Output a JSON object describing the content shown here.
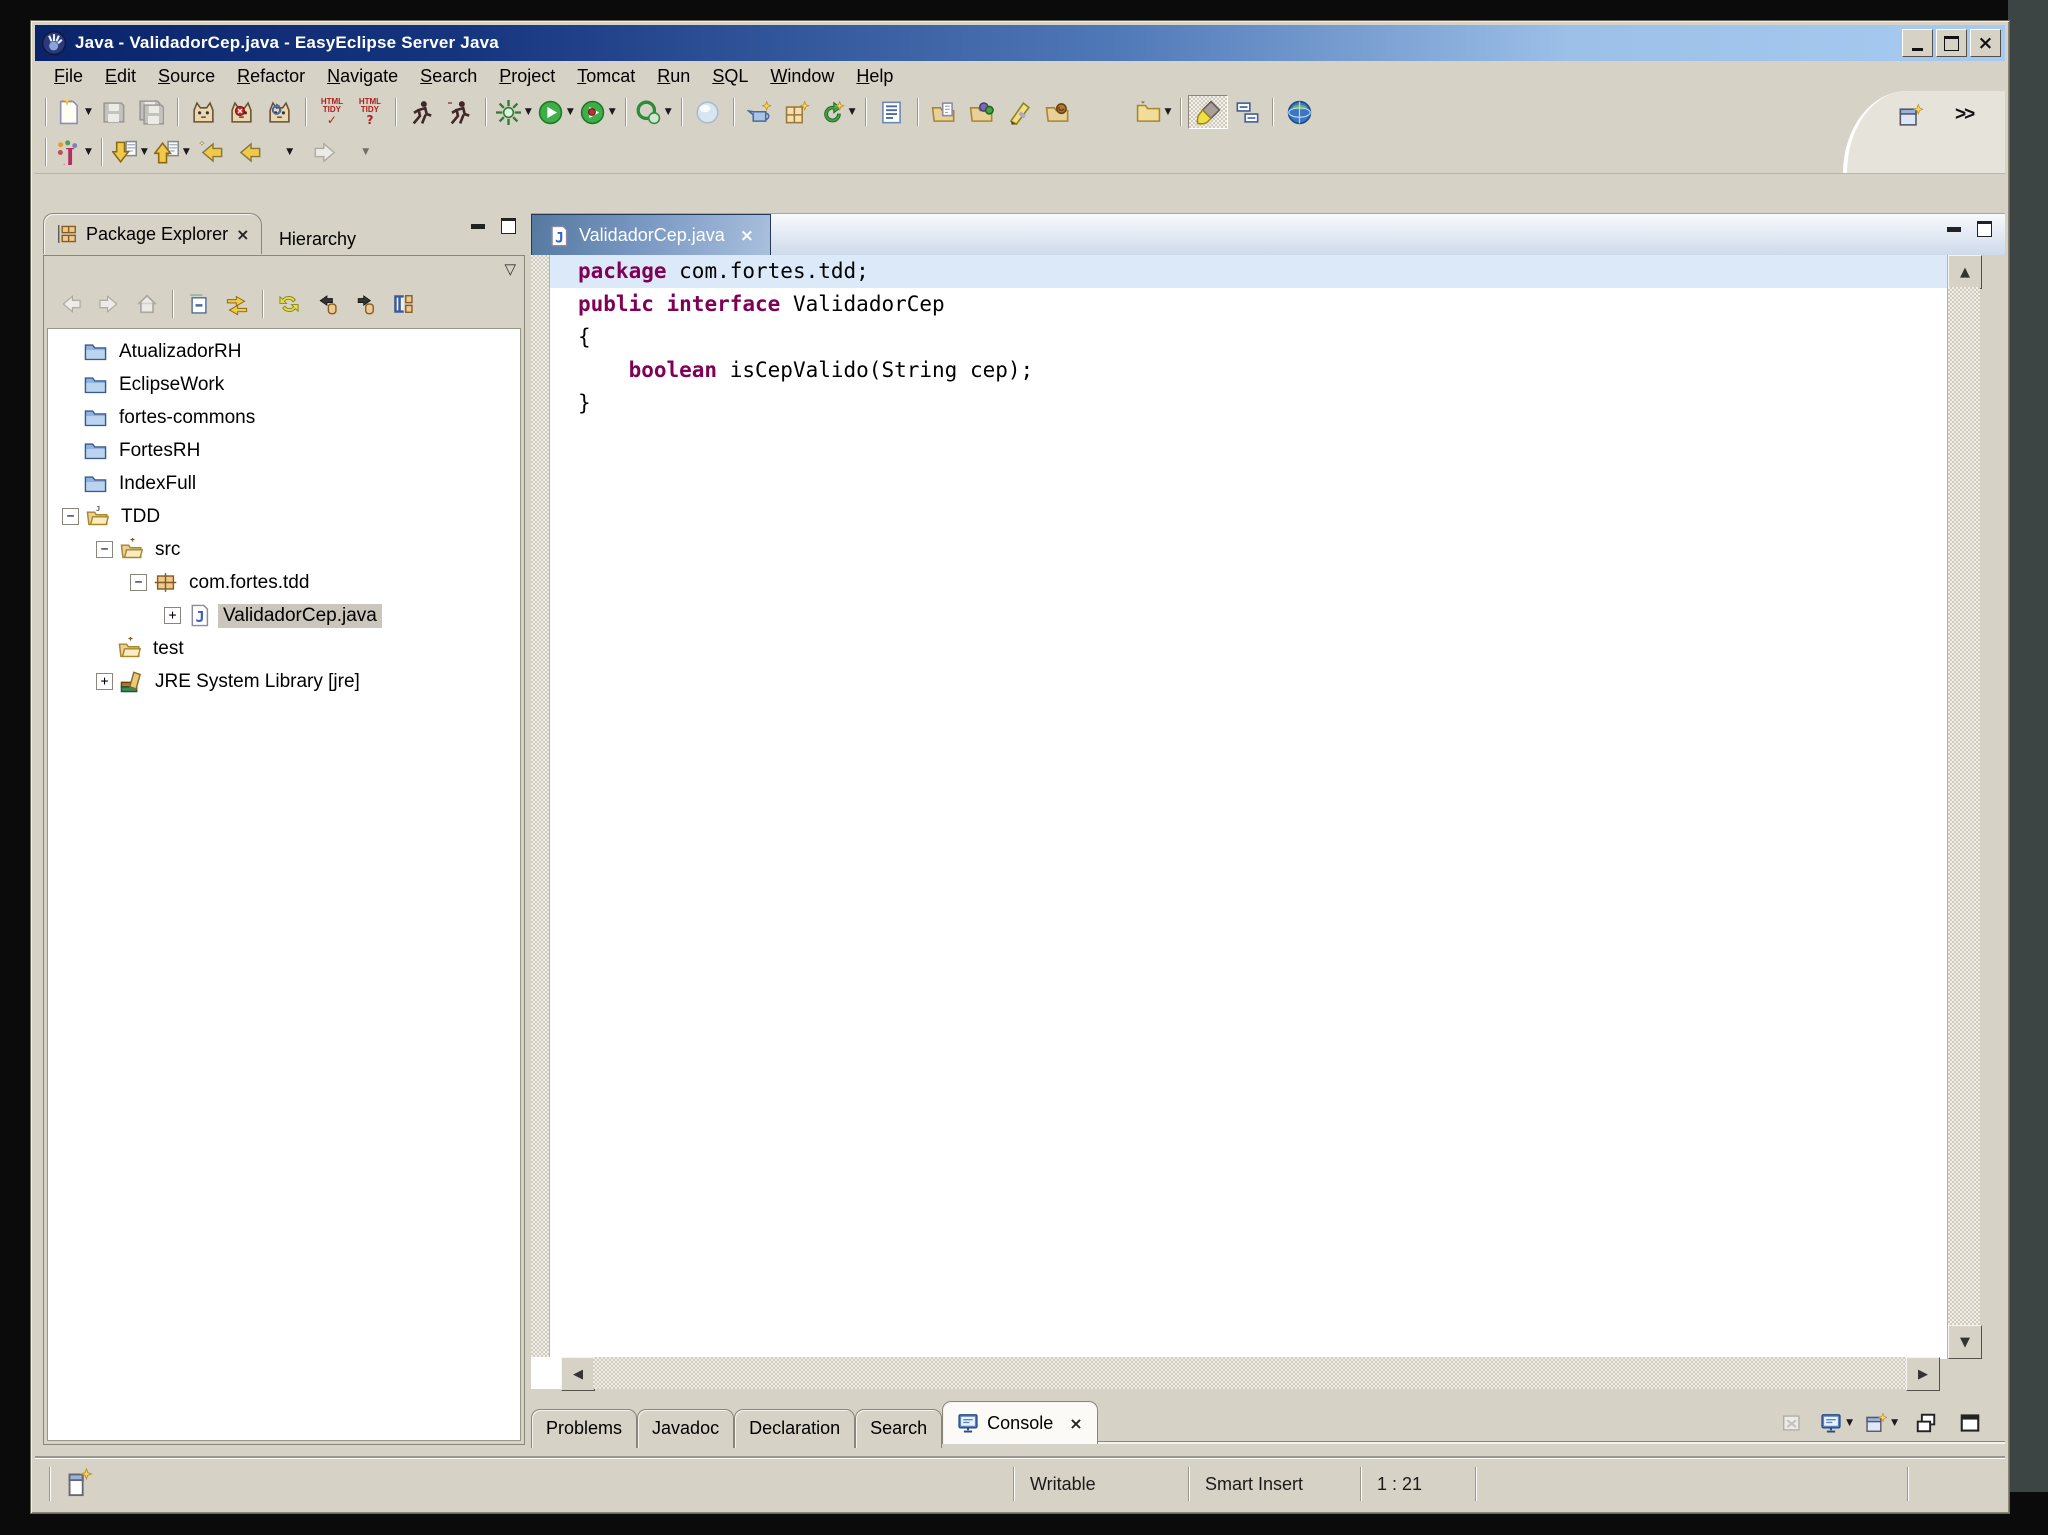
{
  "window": {
    "title": "Java - ValidadorCep.java - EasyEclipse Server Java"
  },
  "menu": {
    "items": [
      "File",
      "Edit",
      "Source",
      "Refactor",
      "Navigate",
      "Search",
      "Project",
      "Tomcat",
      "Run",
      "SQL",
      "Window",
      "Help"
    ]
  },
  "toolbar": {
    "html_tidy_check": {
      "line1": "HTML",
      "line2": "TIDY",
      "mark": "✓"
    },
    "html_tidy_help": {
      "line1": "HTML",
      "line2": "TIDY",
      "mark": "?"
    },
    "perspective_more": ">>",
    "icon_names": [
      "new-wizard",
      "save",
      "save-all",
      "tomcat-start",
      "tomcat-stop",
      "tomcat-restart",
      "html-tidy-check",
      "html-tidy-help",
      "run-jsp",
      "run-servlet",
      "debug",
      "run",
      "run-last",
      "external-tools",
      "sphere",
      "new-server-wizard",
      "new-table-wizard",
      "refresh-wizard",
      "properties-doc",
      "open-file-folder",
      "open-module-folder",
      "pen",
      "open-resource-folder",
      "folder-menu",
      "paint-brush",
      "outline",
      "web-browser",
      "open-perspective",
      "new-java-element",
      "next-annotation",
      "previous-annotation",
      "last-edit-location",
      "back",
      "forward"
    ]
  },
  "package_explorer": {
    "tab_label": "Package Explorer",
    "tab_close_glyph": "×",
    "hierarchy_tab_label": "Hierarchy",
    "toolbar_icon_names": [
      "back",
      "forward",
      "up",
      "collapse-all",
      "link-with-editor",
      "refresh",
      "previous-package",
      "next-package",
      "layout"
    ],
    "tree": [
      {
        "label": "AtualizadorRH",
        "level": 0,
        "expander": "none",
        "icon": "project-closed-folder",
        "selected": false
      },
      {
        "label": "EclipseWork",
        "level": 0,
        "expander": "none",
        "icon": "project-closed-folder",
        "selected": false
      },
      {
        "label": "fortes-commons",
        "level": 0,
        "expander": "none",
        "icon": "project-closed-folder",
        "selected": false
      },
      {
        "label": "FortesRH",
        "level": 0,
        "expander": "none",
        "icon": "project-closed-folder",
        "selected": false
      },
      {
        "label": "IndexFull",
        "level": 0,
        "expander": "none",
        "icon": "project-closed-folder",
        "selected": false
      },
      {
        "label": "TDD",
        "level": 0,
        "expander": "minus",
        "icon": "java-project-open-folder",
        "selected": false
      },
      {
        "label": "src",
        "level": 1,
        "expander": "minus",
        "icon": "source-folder",
        "selected": false
      },
      {
        "label": "com.fortes.tdd",
        "level": 2,
        "expander": "minus",
        "icon": "package",
        "selected": false
      },
      {
        "label": "ValidadorCep.java",
        "level": 3,
        "expander": "plus",
        "icon": "java-file",
        "selected": true
      },
      {
        "label": "test",
        "level": 1,
        "expander": "none",
        "icon": "source-folder",
        "selected": false
      },
      {
        "label": "JRE System Library [jre]",
        "level": 1,
        "expander": "plus",
        "icon": "library",
        "selected": false
      }
    ]
  },
  "editor": {
    "tab_label": "ValidadorCep.java",
    "tab_close_glyph": "×",
    "code": {
      "l1": [
        "package",
        " com.fortes.tdd;"
      ],
      "l2": [
        ""
      ],
      "l3": [
        "public",
        " ",
        "interface",
        " ValidadorCep"
      ],
      "l4": [
        "{"
      ],
      "l5": [
        "    ",
        "boolean",
        " isCepValido(String cep);"
      ],
      "l6": [
        "}"
      ]
    }
  },
  "bottom_tabs": {
    "labels": [
      "Problems",
      "Javadoc",
      "Declaration",
      "Search",
      "Console"
    ],
    "active": "Console",
    "console_close_glyph": "×",
    "toolbar_icon_names": [
      "clear-console",
      "display-selected-console",
      "open-console",
      "restore-view",
      "maximize-view"
    ]
  },
  "status_bar": {
    "writable": "Writable",
    "insert_mode": "Smart Insert",
    "cursor_position": "1 : 21"
  },
  "colors": {
    "titlebar_start": "#0a246a",
    "titlebar_end": "#a6caf0",
    "chrome": "#d6d2c6",
    "keyword": "#7f0055",
    "editor_line_highlight": "#dce9f8",
    "inactive_selection": "#cac6bc",
    "desktop_right_band": "#3d4444"
  }
}
